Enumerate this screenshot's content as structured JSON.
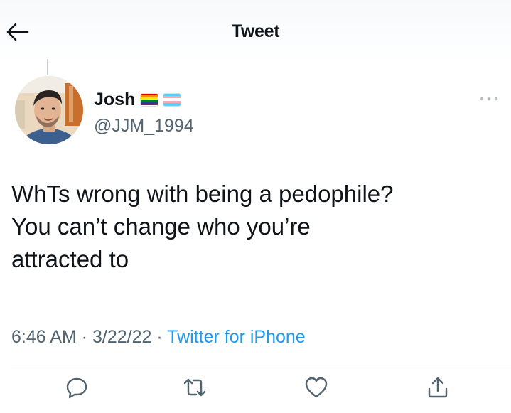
{
  "header": {
    "title": "Tweet",
    "back_icon": "back-arrow-icon"
  },
  "author": {
    "name": "Josh",
    "handle": "@JJM_1994",
    "flags": [
      {
        "icon": "rainbow-flag-icon",
        "colors": [
          "#e40303",
          "#ff8c00",
          "#ffed00",
          "#008026",
          "#24408e",
          "#732982"
        ]
      },
      {
        "icon": "transgender-flag-icon",
        "colors": [
          "#5bcefa",
          "#f5a9b8",
          "#ffffff",
          "#f5a9b8",
          "#5bcefa"
        ]
      }
    ]
  },
  "tweet": {
    "lines": [
      "WhTs wrong with being a pedophile?",
      "You can’t change who you’re",
      "attracted to"
    ],
    "time": "6:46 AM",
    "separator": "·",
    "date": "3/22/22",
    "source": "Twitter for iPhone"
  },
  "actions": [
    {
      "icon": "reply-icon"
    },
    {
      "icon": "retweet-icon"
    },
    {
      "icon": "like-icon"
    },
    {
      "icon": "share-icon"
    }
  ],
  "colors": {
    "text": "#0f1419",
    "secondary": "#536471",
    "accent": "#1d9bf0"
  }
}
